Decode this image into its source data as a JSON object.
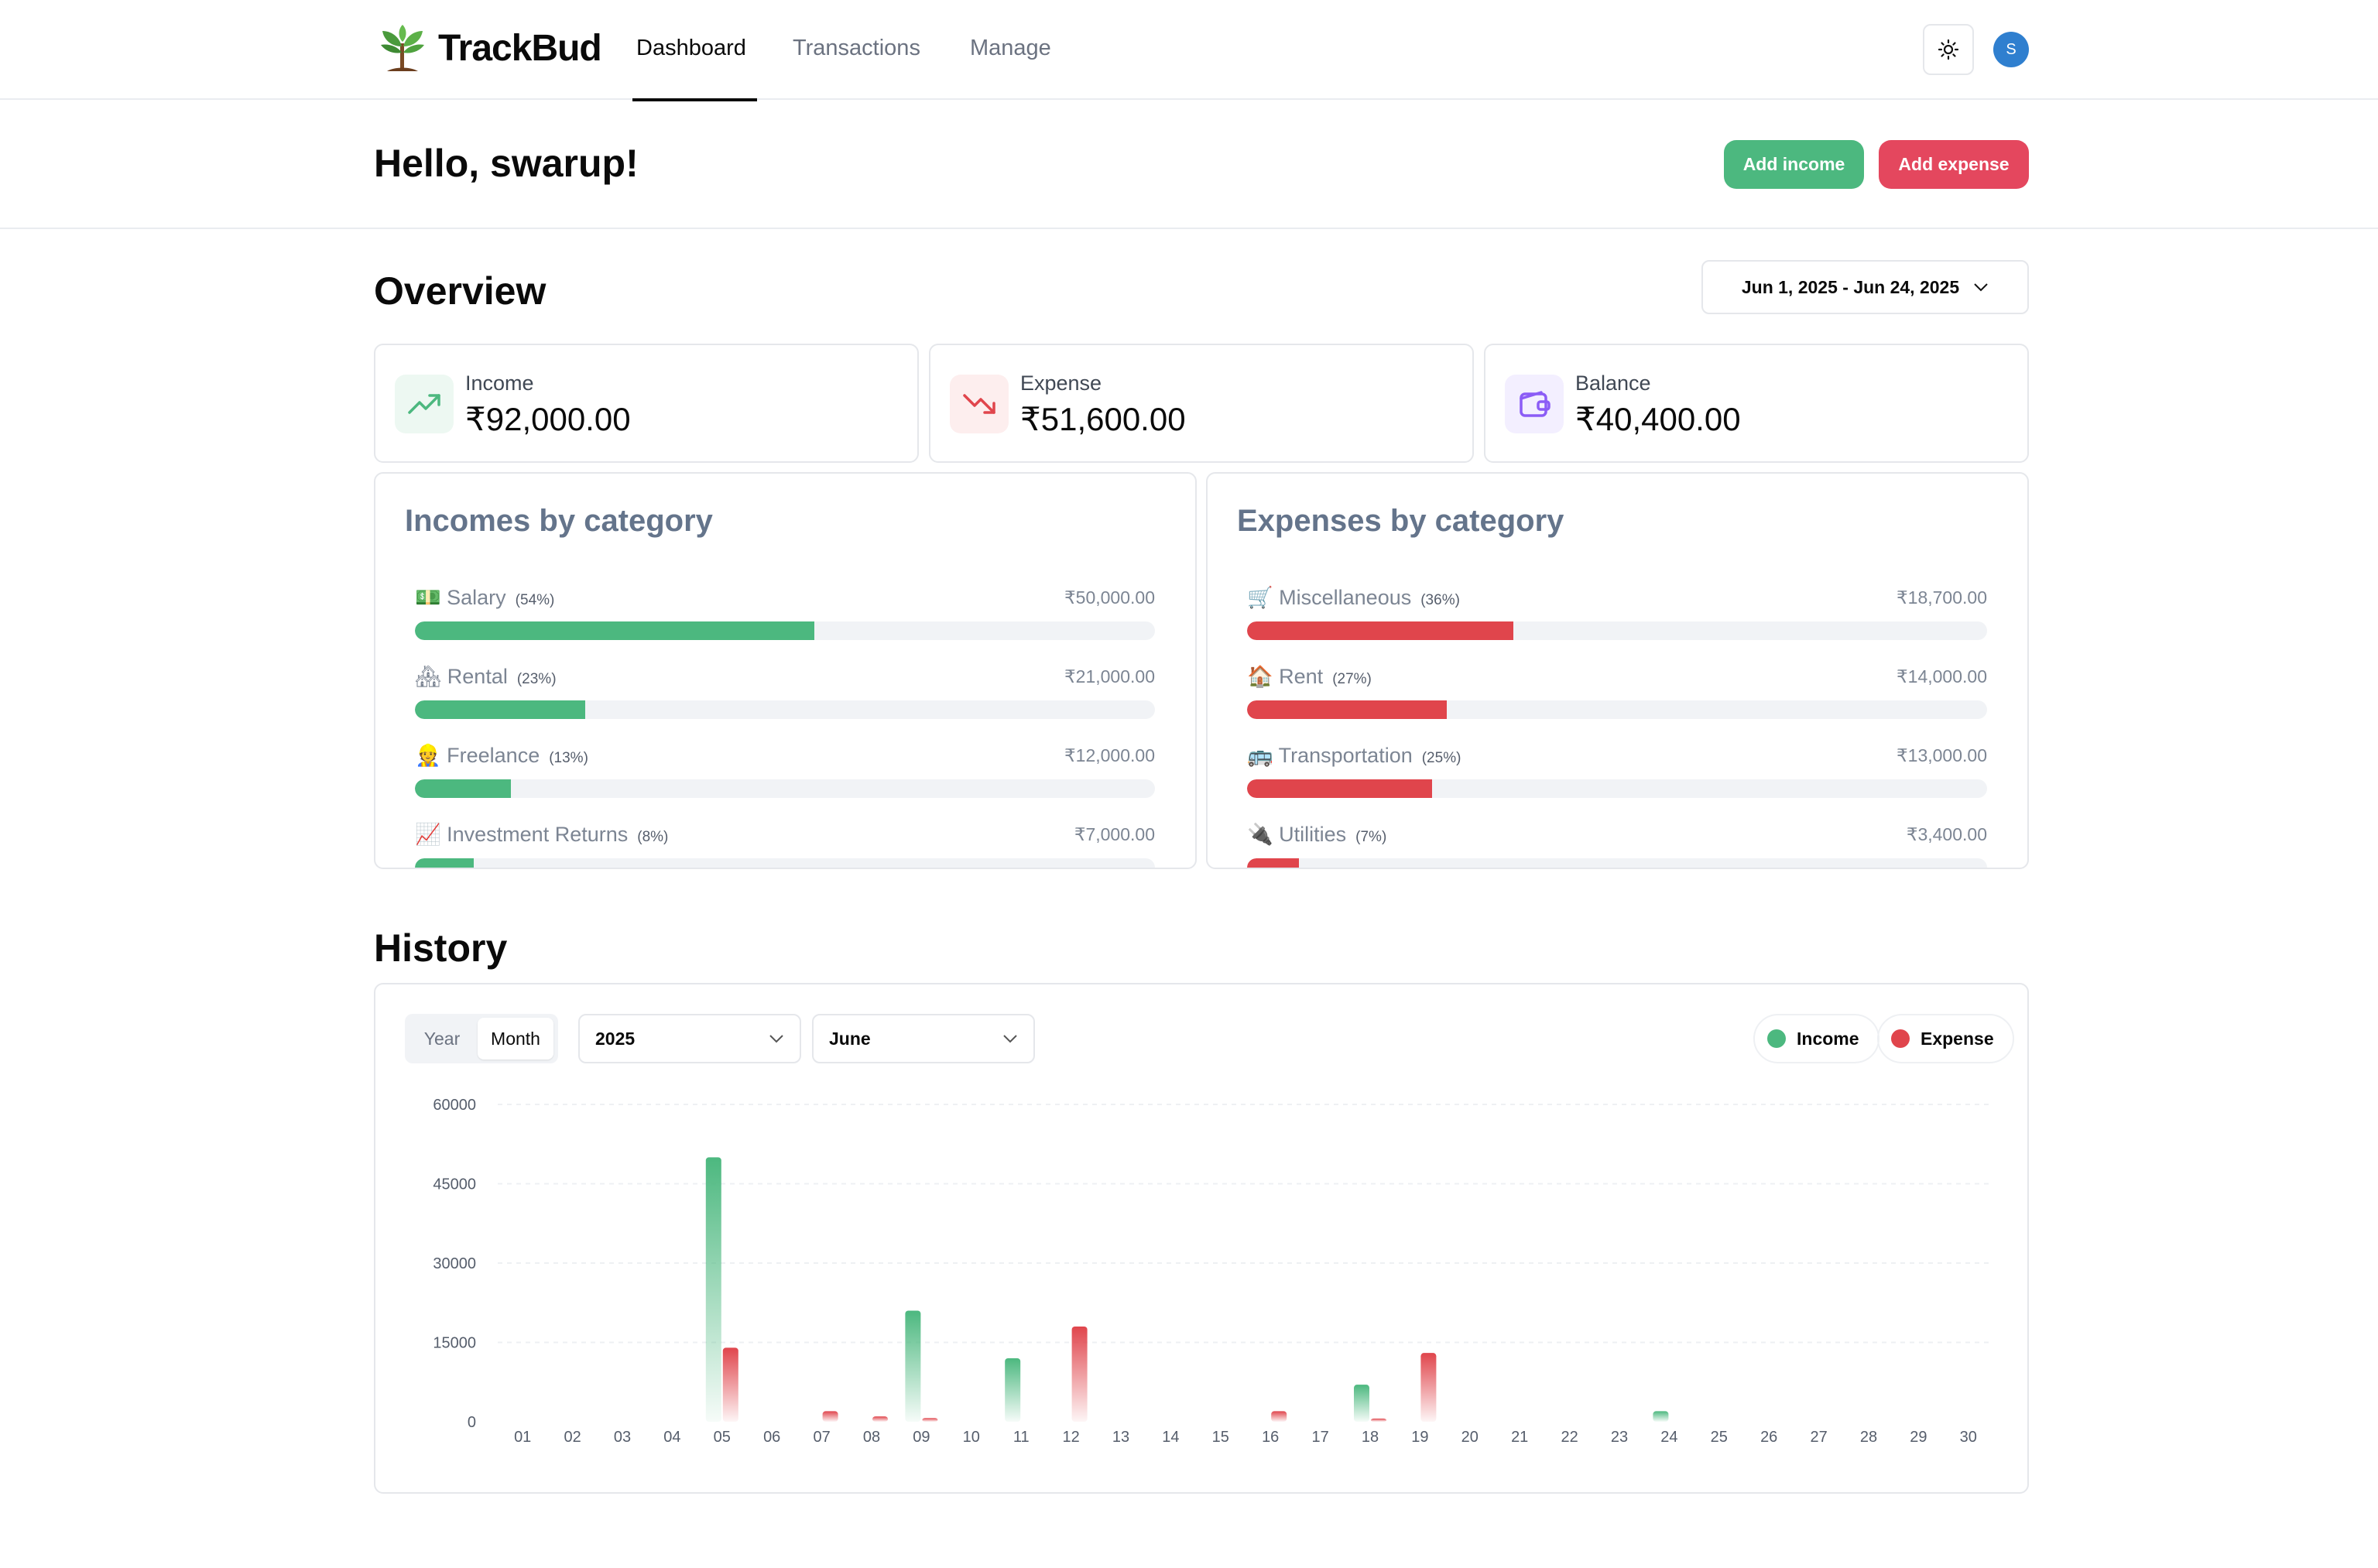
{
  "header": {
    "brand": "TrackBud",
    "tabs": [
      {
        "label": "Dashboard"
      },
      {
        "label": "Transactions"
      },
      {
        "label": "Manage"
      }
    ],
    "user_initial": "S"
  },
  "greeting": {
    "text": "Hello, swarup!",
    "add_income_label": "Add income",
    "add_expense_label": "Add expense"
  },
  "overview": {
    "title": "Overview",
    "date_range": "Jun 1, 2025 - Jun 24, 2025",
    "stats": [
      {
        "label": "Income",
        "value": "₹92,000.00",
        "icon": "trending-up-icon",
        "color": "#4cb87f"
      },
      {
        "label": "Expense",
        "value": "₹51,600.00",
        "icon": "trending-down-icon",
        "color": "#e0454c"
      },
      {
        "label": "Balance",
        "value": "₹40,400.00",
        "icon": "wallet-icon",
        "color": "#8b5cf6"
      }
    ]
  },
  "incomes_by_category": {
    "title": "Incomes by category",
    "items": [
      {
        "emoji": "💵",
        "name": "Salary",
        "pct_label": "(54%)",
        "pct": 54,
        "amount": "₹50,000.00"
      },
      {
        "emoji": "🏘",
        "name": "Rental",
        "pct_label": "(23%)",
        "pct": 23,
        "amount": "₹21,000.00"
      },
      {
        "emoji": "👷",
        "name": "Freelance",
        "pct_label": "(13%)",
        "pct": 13,
        "amount": "₹12,000.00"
      },
      {
        "emoji": "📈",
        "name": "Investment Returns",
        "pct_label": "(8%)",
        "pct": 8,
        "amount": "₹7,000.00"
      }
    ]
  },
  "expenses_by_category": {
    "title": "Expenses by category",
    "items": [
      {
        "emoji": "🛒",
        "name": "Miscellaneous",
        "pct_label": "(36%)",
        "pct": 36,
        "amount": "₹18,700.00"
      },
      {
        "emoji": "🏠",
        "name": "Rent",
        "pct_label": "(27%)",
        "pct": 27,
        "amount": "₹14,000.00"
      },
      {
        "emoji": "🚌",
        "name": "Transportation",
        "pct_label": "(25%)",
        "pct": 25,
        "amount": "₹13,000.00"
      },
      {
        "emoji": "🔌",
        "name": "Utilities",
        "pct_label": "(7%)",
        "pct": 7,
        "amount": "₹3,400.00"
      }
    ]
  },
  "history": {
    "title": "History",
    "timeframe_options": [
      "Year",
      "Month"
    ],
    "timeframe_selected": "Month",
    "year_value": "2025",
    "month_value": "June",
    "legend": [
      {
        "label": "Income",
        "color": "#4cb87f"
      },
      {
        "label": "Expense",
        "color": "#e0454c"
      }
    ]
  },
  "colors": {
    "income": "#4cb87f",
    "expense": "#e0454c",
    "income_button": "#4cb87f",
    "expense_button": "#e4475e"
  },
  "chart_data": {
    "type": "bar",
    "categories": [
      "01",
      "02",
      "03",
      "04",
      "05",
      "06",
      "07",
      "08",
      "09",
      "10",
      "11",
      "12",
      "13",
      "14",
      "15",
      "16",
      "17",
      "18",
      "19",
      "20",
      "21",
      "22",
      "23",
      "24",
      "25",
      "26",
      "27",
      "28",
      "29",
      "30"
    ],
    "series": [
      {
        "name": "Income",
        "values": [
          0,
          0,
          0,
          0,
          50000,
          0,
          0,
          0,
          21000,
          0,
          12000,
          0,
          0,
          0,
          0,
          0,
          0,
          7000,
          0,
          0,
          0,
          0,
          0,
          2000,
          0,
          0,
          0,
          0,
          0,
          0
        ]
      },
      {
        "name": "Expense",
        "values": [
          0,
          0,
          0,
          0,
          14000,
          0,
          2000,
          1000,
          700,
          0,
          0,
          18000,
          0,
          0,
          0,
          2000,
          0,
          600,
          13000,
          0,
          0,
          0,
          0,
          0,
          0,
          0,
          0,
          0,
          0,
          0
        ]
      }
    ],
    "yticks": [
      0,
      15000,
      30000,
      45000,
      60000
    ],
    "ylim": [
      0,
      60000
    ],
    "grid": true,
    "legend": "top-right"
  }
}
